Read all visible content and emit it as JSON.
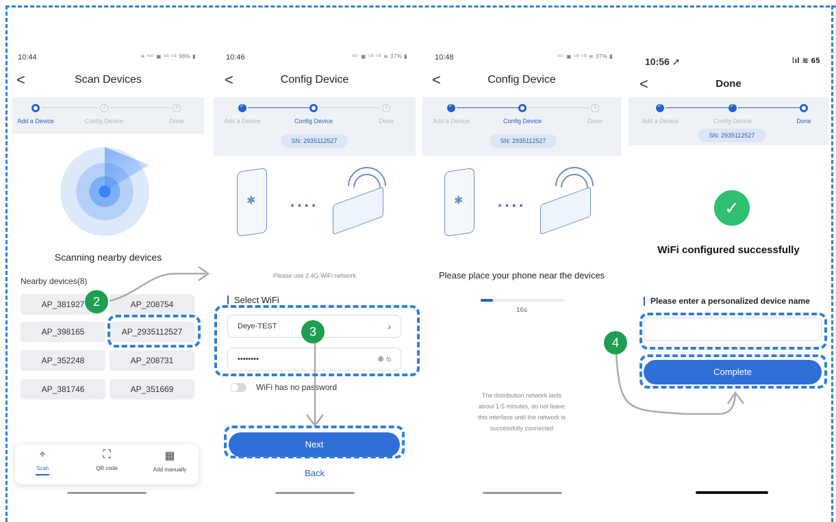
{
  "screen1": {
    "time": "10:44",
    "status_icons": "✳ ⁸²⁷ ▣ ⁵ᴳ ⁵ᴳ 38% ▮",
    "back": "<",
    "title": "Scan Devices",
    "steps": [
      {
        "num": "1",
        "label": "Add a Device"
      },
      {
        "num": "2",
        "label": "Config Device"
      },
      {
        "num": "3",
        "label": "Done"
      }
    ],
    "scanning_text": "Scanning nearby devices",
    "nearby_label": "Nearby devices(8)",
    "devices": [
      "AP_381927",
      "AP_208754",
      "AP_398165",
      "AP_2935112527",
      "AP_352248",
      "AP_208731",
      "AP_381746",
      "AP_351669"
    ],
    "tabs": [
      {
        "label": "Scan",
        "icon": "scan-icon"
      },
      {
        "label": "QR code",
        "icon": "qr-code-icon"
      },
      {
        "label": "Add manually",
        "icon": "grid-icon"
      }
    ]
  },
  "screen2": {
    "time": "10:46",
    "status_icons": "⁸²⁷ ▣ ⁵ᴳ ⁵ᴳ ≋ 37% ▮",
    "back": "<",
    "title": "Config Device",
    "steps": [
      {
        "num": "1",
        "label": "Add a Device"
      },
      {
        "num": "2",
        "label": "Config Device"
      },
      {
        "num": "3",
        "label": "Done"
      }
    ],
    "sn": "SN: 2935112527",
    "network_hint": "Please use 2.4G WiFi network",
    "select_wifi": "Select WiFi",
    "ssid": "Deye-TEST",
    "password_mask": "••••••••",
    "toggle_label": "WiFi has no password",
    "next_label": "Next",
    "back_label": "Back"
  },
  "screen3": {
    "time": "10:48",
    "status_icons": "⁸²⁷ ▣ ⁵ᴳ ⁵ᴳ ≋ 37% ▮",
    "back": "<",
    "title": "Config Device",
    "steps": [
      {
        "num": "1",
        "label": "Add a Device"
      },
      {
        "num": "2",
        "label": "Config Device"
      },
      {
        "num": "3",
        "label": "Done"
      }
    ],
    "sn": "SN: 2935112527",
    "instruction": "Please place your phone near the devices",
    "progress_fraction": 0.15,
    "countdown": "16s",
    "note_lines": [
      "The distribution network lasts",
      "about 1-5 minutes, do not leave",
      "this interface until the network is",
      "successfully connected"
    ]
  },
  "screen4": {
    "time": "10:56 ➚",
    "status_icons": "⁞ıl ≋ 65",
    "back": "<",
    "title": "Done",
    "steps": [
      {
        "num": "1",
        "label": "Add a Device"
      },
      {
        "num": "2",
        "label": "Config Device"
      },
      {
        "num": "3",
        "label": "Done"
      }
    ],
    "sn": "SN: 2935112527",
    "success_text": "WiFi configured successfully",
    "name_prompt": "Please enter a personalized device name",
    "complete_label": "Complete"
  },
  "badges": [
    "2",
    "3",
    "4"
  ],
  "colors": {
    "accent": "#2563c9",
    "highlight": "#2f80d8",
    "badge": "#1e9e52",
    "success": "#2fbf71"
  }
}
